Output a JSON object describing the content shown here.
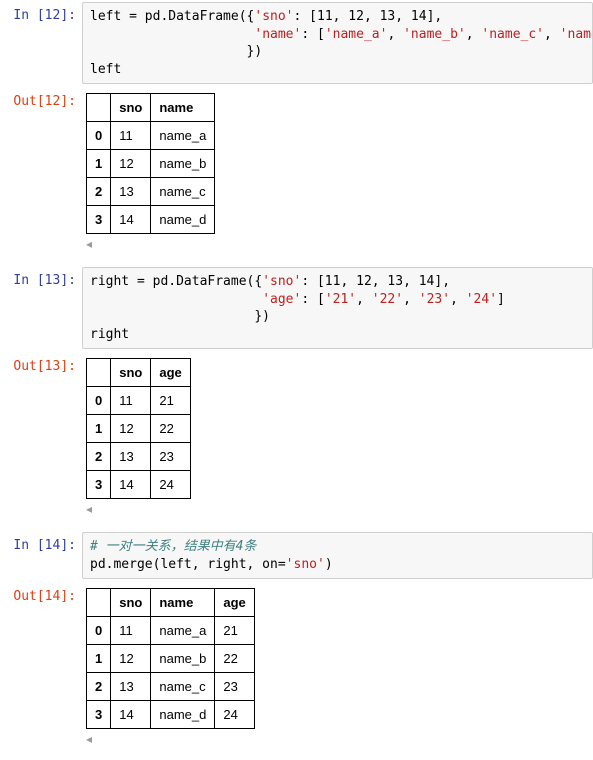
{
  "cells": [
    {
      "in_label": "In  [12]: ",
      "code_tokens": [
        {
          "t": "left = pd.DataFrame({"
        },
        {
          "t": "'sno'",
          "c": "s-str"
        },
        {
          "t": ": [11, 12, 13, 14],\n                     "
        },
        {
          "t": "'name'",
          "c": "s-str"
        },
        {
          "t": ": ["
        },
        {
          "t": "'name_a'",
          "c": "s-str"
        },
        {
          "t": ", "
        },
        {
          "t": "'name_b'",
          "c": "s-str"
        },
        {
          "t": ", "
        },
        {
          "t": "'name_c'",
          "c": "s-str"
        },
        {
          "t": ", "
        },
        {
          "t": "'name_d'",
          "c": "s-str"
        },
        {
          "t": "]\n                    })\nleft"
        }
      ],
      "out_label": "Out[12]: ",
      "table": {
        "columns": [
          "",
          "sno",
          "name"
        ],
        "rows": [
          [
            "0",
            "11",
            "name_a"
          ],
          [
            "1",
            "12",
            "name_b"
          ],
          [
            "2",
            "13",
            "name_c"
          ],
          [
            "3",
            "14",
            "name_d"
          ]
        ]
      }
    },
    {
      "in_label": "In  [13]: ",
      "code_tokens": [
        {
          "t": "right = pd.DataFrame({"
        },
        {
          "t": "'sno'",
          "c": "s-str"
        },
        {
          "t": ": [11, 12, 13, 14],\n                      "
        },
        {
          "t": "'age'",
          "c": "s-str"
        },
        {
          "t": ": ["
        },
        {
          "t": "'21'",
          "c": "s-str"
        },
        {
          "t": ", "
        },
        {
          "t": "'22'",
          "c": "s-str"
        },
        {
          "t": ", "
        },
        {
          "t": "'23'",
          "c": "s-str"
        },
        {
          "t": ", "
        },
        {
          "t": "'24'",
          "c": "s-str"
        },
        {
          "t": "]\n                     })\nright"
        }
      ],
      "out_label": "Out[13]: ",
      "table": {
        "columns": [
          "",
          "sno",
          "age"
        ],
        "rows": [
          [
            "0",
            "11",
            "21"
          ],
          [
            "1",
            "12",
            "22"
          ],
          [
            "2",
            "13",
            "23"
          ],
          [
            "3",
            "14",
            "24"
          ]
        ]
      }
    },
    {
      "in_label": "In  [14]: ",
      "code_tokens": [
        {
          "t": "# 一对一关系，结果中有4条",
          "c": "s-cmt"
        },
        {
          "t": "\npd.merge(left, right, on="
        },
        {
          "t": "'sno'",
          "c": "s-str"
        },
        {
          "t": ")"
        }
      ],
      "out_label": "Out[14]: ",
      "table": {
        "columns": [
          "",
          "sno",
          "name",
          "age"
        ],
        "rows": [
          [
            "0",
            "11",
            "name_a",
            "21"
          ],
          [
            "1",
            "12",
            "name_b",
            "22"
          ],
          [
            "2",
            "13",
            "name_c",
            "23"
          ],
          [
            "3",
            "14",
            "name_d",
            "24"
          ]
        ]
      }
    }
  ],
  "scroll_glyph": "◂"
}
